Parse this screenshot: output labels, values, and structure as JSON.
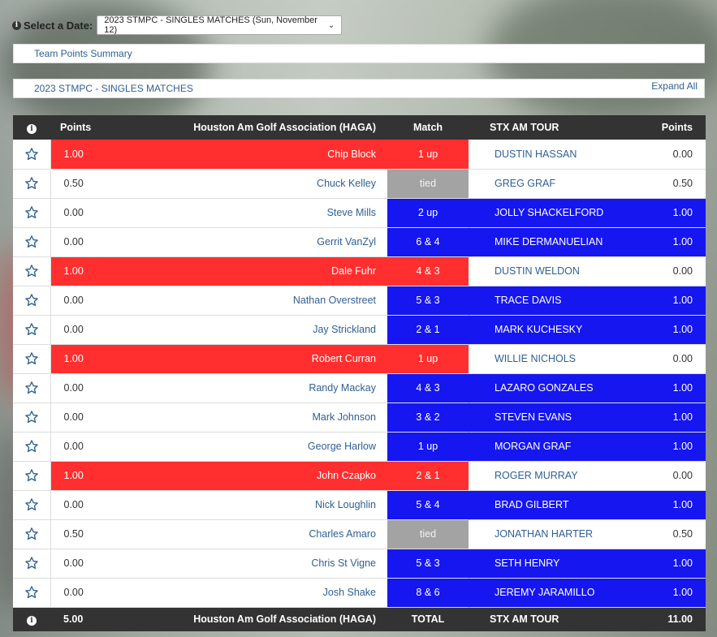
{
  "date_selector": {
    "label": "Select a Date:",
    "selected": "2023 STMPC - SINGLES MATCHES (Sun, November 12)"
  },
  "team_points_summary": "Team Points Summary",
  "section": {
    "title": "2023 STMPC - SINGLES MATCHES",
    "expand_label": "Expand All"
  },
  "header": {
    "info": "i",
    "left_points": "Points",
    "left_team": "Houston Am Golf Association (HAGA)",
    "match": "Match",
    "right_team": "STX AM TOUR",
    "right_points": "Points"
  },
  "colors": {
    "haga_win": "#ff2f2f",
    "stx_win": "#1616f0",
    "tied": "#a3a3a3"
  },
  "matches": [
    {
      "left_points": "1.00",
      "left_player": "Chip Block",
      "result": "1 up",
      "right_player": "DUSTIN HASSAN",
      "right_points": "0.00",
      "winner": "left"
    },
    {
      "left_points": "0.50",
      "left_player": "Chuck Kelley",
      "result": "tied",
      "right_player": "GREG GRAF",
      "right_points": "0.50",
      "winner": "tie"
    },
    {
      "left_points": "0.00",
      "left_player": "Steve Mills",
      "result": "2 up",
      "right_player": "JOLLY SHACKELFORD",
      "right_points": "1.00",
      "winner": "right"
    },
    {
      "left_points": "0.00",
      "left_player": "Gerrit VanZyl",
      "result": "6 & 4",
      "right_player": "MIKE DERMANUELIAN",
      "right_points": "1.00",
      "winner": "right"
    },
    {
      "left_points": "1.00",
      "left_player": "Dale Fuhr",
      "result": "4 & 3",
      "right_player": "DUSTIN WELDON",
      "right_points": "0.00",
      "winner": "left"
    },
    {
      "left_points": "0.00",
      "left_player": "Nathan Overstreet",
      "result": "5 & 3",
      "right_player": "TRACE DAVIS",
      "right_points": "1.00",
      "winner": "right"
    },
    {
      "left_points": "0.00",
      "left_player": "Jay Strickland",
      "result": "2 & 1",
      "right_player": "MARK KUCHESKY",
      "right_points": "1.00",
      "winner": "right"
    },
    {
      "left_points": "1.00",
      "left_player": "Robert Curran",
      "result": "1 up",
      "right_player": "WILLIE NICHOLS",
      "right_points": "0.00",
      "winner": "left"
    },
    {
      "left_points": "0.00",
      "left_player": "Randy Mackay",
      "result": "4 & 3",
      "right_player": "LAZARO GONZALES",
      "right_points": "1.00",
      "winner": "right"
    },
    {
      "left_points": "0.00",
      "left_player": "Mark Johnson",
      "result": "3 & 2",
      "right_player": "STEVEN EVANS",
      "right_points": "1.00",
      "winner": "right"
    },
    {
      "left_points": "0.00",
      "left_player": "George Harlow",
      "result": "1 up",
      "right_player": "MORGAN GRAF",
      "right_points": "1.00",
      "winner": "right"
    },
    {
      "left_points": "1.00",
      "left_player": "John Czapko",
      "result": "2 & 1",
      "right_player": "ROGER MURRAY",
      "right_points": "0.00",
      "winner": "left"
    },
    {
      "left_points": "0.00",
      "left_player": "Nick Loughlin",
      "result": "5 & 4",
      "right_player": "BRAD GILBERT",
      "right_points": "1.00",
      "winner": "right"
    },
    {
      "left_points": "0.50",
      "left_player": "Charles Amaro",
      "result": "tied",
      "right_player": "JONATHAN HARTER",
      "right_points": "0.50",
      "winner": "tie"
    },
    {
      "left_points": "0.00",
      "left_player": "Chris St Vigne",
      "result": "5 & 3",
      "right_player": "SETH HENRY",
      "right_points": "1.00",
      "winner": "right"
    },
    {
      "left_points": "0.00",
      "left_player": "Josh Shake",
      "result": "8 & 6",
      "right_player": "JEREMY JARAMILLO",
      "right_points": "1.00",
      "winner": "right"
    }
  ],
  "footer": {
    "info": "i",
    "left_total": "5.00",
    "left_team": "Houston Am Golf Association (HAGA)",
    "label": "TOTAL",
    "right_team": "STX AM TOUR",
    "right_total": "11.00"
  }
}
